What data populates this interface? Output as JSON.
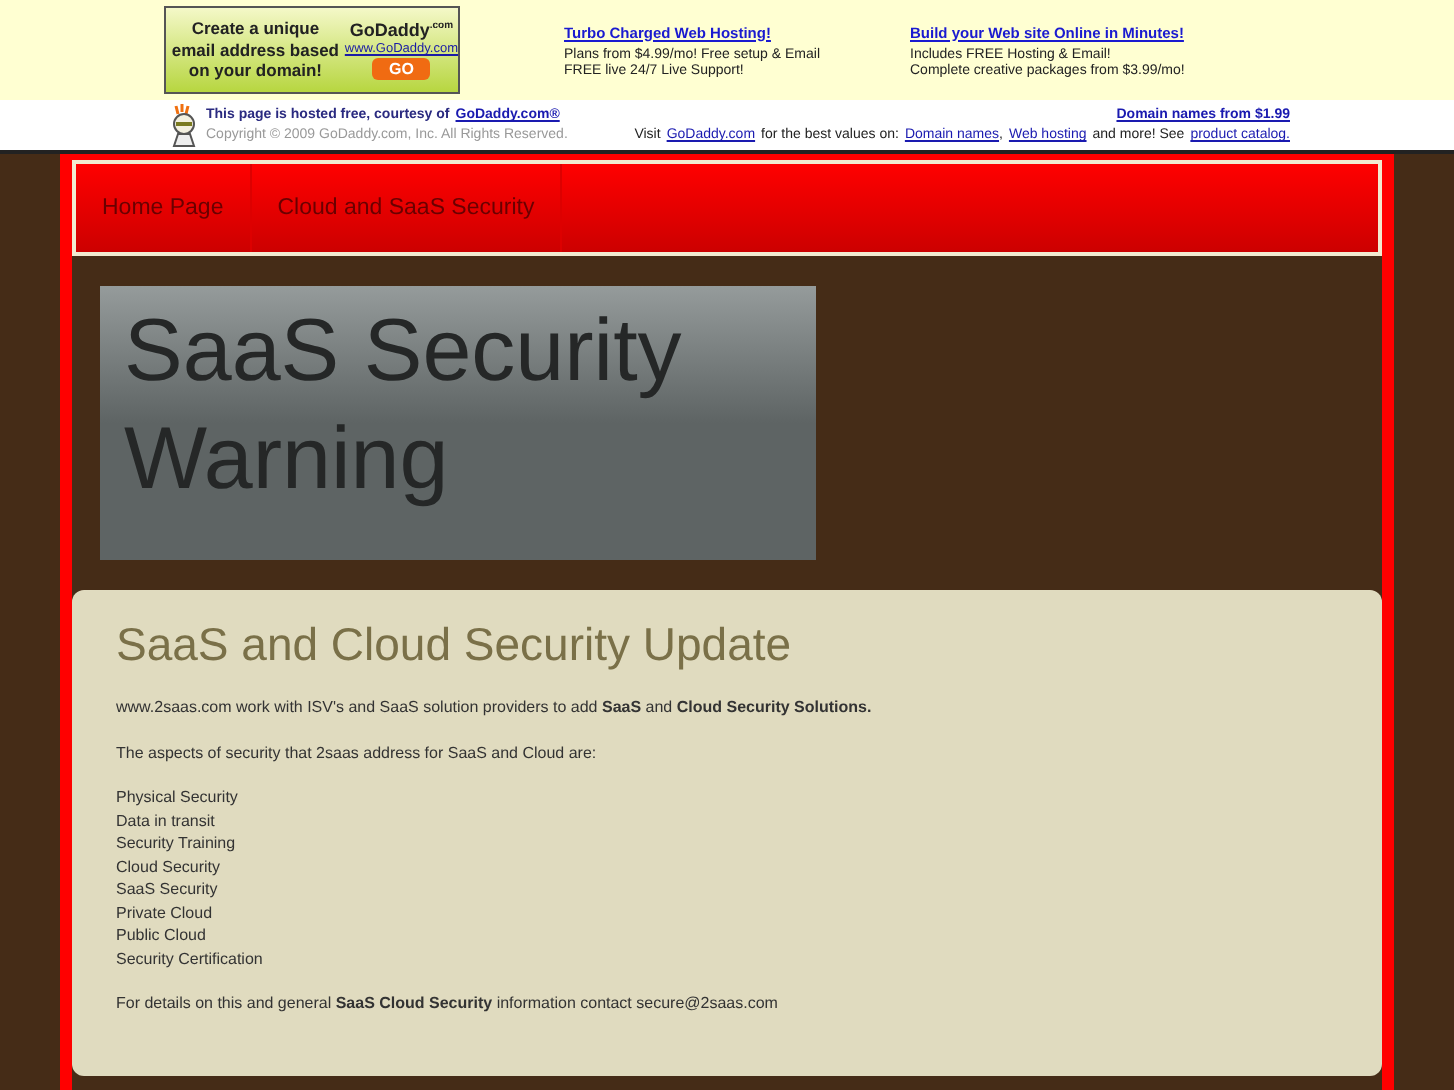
{
  "ad_banner": {
    "lines": [
      "Create a unique",
      "email address based",
      "on your domain!"
    ],
    "logo": "GoDaddy",
    "logo_suffix": ".com",
    "url": "www.GoDaddy.com",
    "button": "GO"
  },
  "promos": [
    {
      "title": "Turbo Charged Web Hosting!",
      "lines": [
        "Plans from $4.99/mo! Free setup & Email",
        "FREE live 24/7 Live Support!"
      ]
    },
    {
      "title": "Build your Web site Online in Minutes!",
      "lines": [
        "Includes FREE Hosting & Email!",
        "Complete creative packages from $3.99/mo!"
      ]
    }
  ],
  "host_bar": {
    "hosted_text": "This page is hosted free, courtesy of",
    "hosted_link": "GoDaddy.com®",
    "copyright": "Copyright © 2009 GoDaddy.com, Inc. All Rights Reserved.",
    "domain_link": "Domain names from $1.99",
    "visit_parts": [
      {
        "kind": "text",
        "text": "Visit"
      },
      {
        "kind": "link",
        "text": "GoDaddy.com"
      },
      {
        "kind": "text",
        "text": "for the best values on:"
      },
      {
        "kind": "link",
        "text": "Domain names"
      },
      {
        "kind": "text",
        "text": ","
      },
      {
        "kind": "link",
        "text": "Web hosting"
      },
      {
        "kind": "text",
        "text": "and more! See"
      },
      {
        "kind": "link",
        "text": "product catalog."
      }
    ]
  },
  "nav": [
    "Home Page",
    "Cloud and SaaS Security"
  ],
  "header_title": "SaaS Security Warning",
  "content": {
    "title": "SaaS and Cloud Security Update",
    "paragraphs": [
      "www.2saas.com work with ISV's and SaaS solution providers to add **SaaS** and **Cloud Security Solutions.**",
      "The aspects of security that 2saas address for SaaS and Cloud are:"
    ],
    "list": [
      "Physical Security",
      "Data in transit",
      "Security Training",
      "Cloud Security",
      "SaaS Security",
      "Private Cloud",
      "Public Cloud",
      "Security Certification"
    ],
    "footer": "For details on this and general **SaaS Cloud Security** information contact secure@2saas.com"
  }
}
